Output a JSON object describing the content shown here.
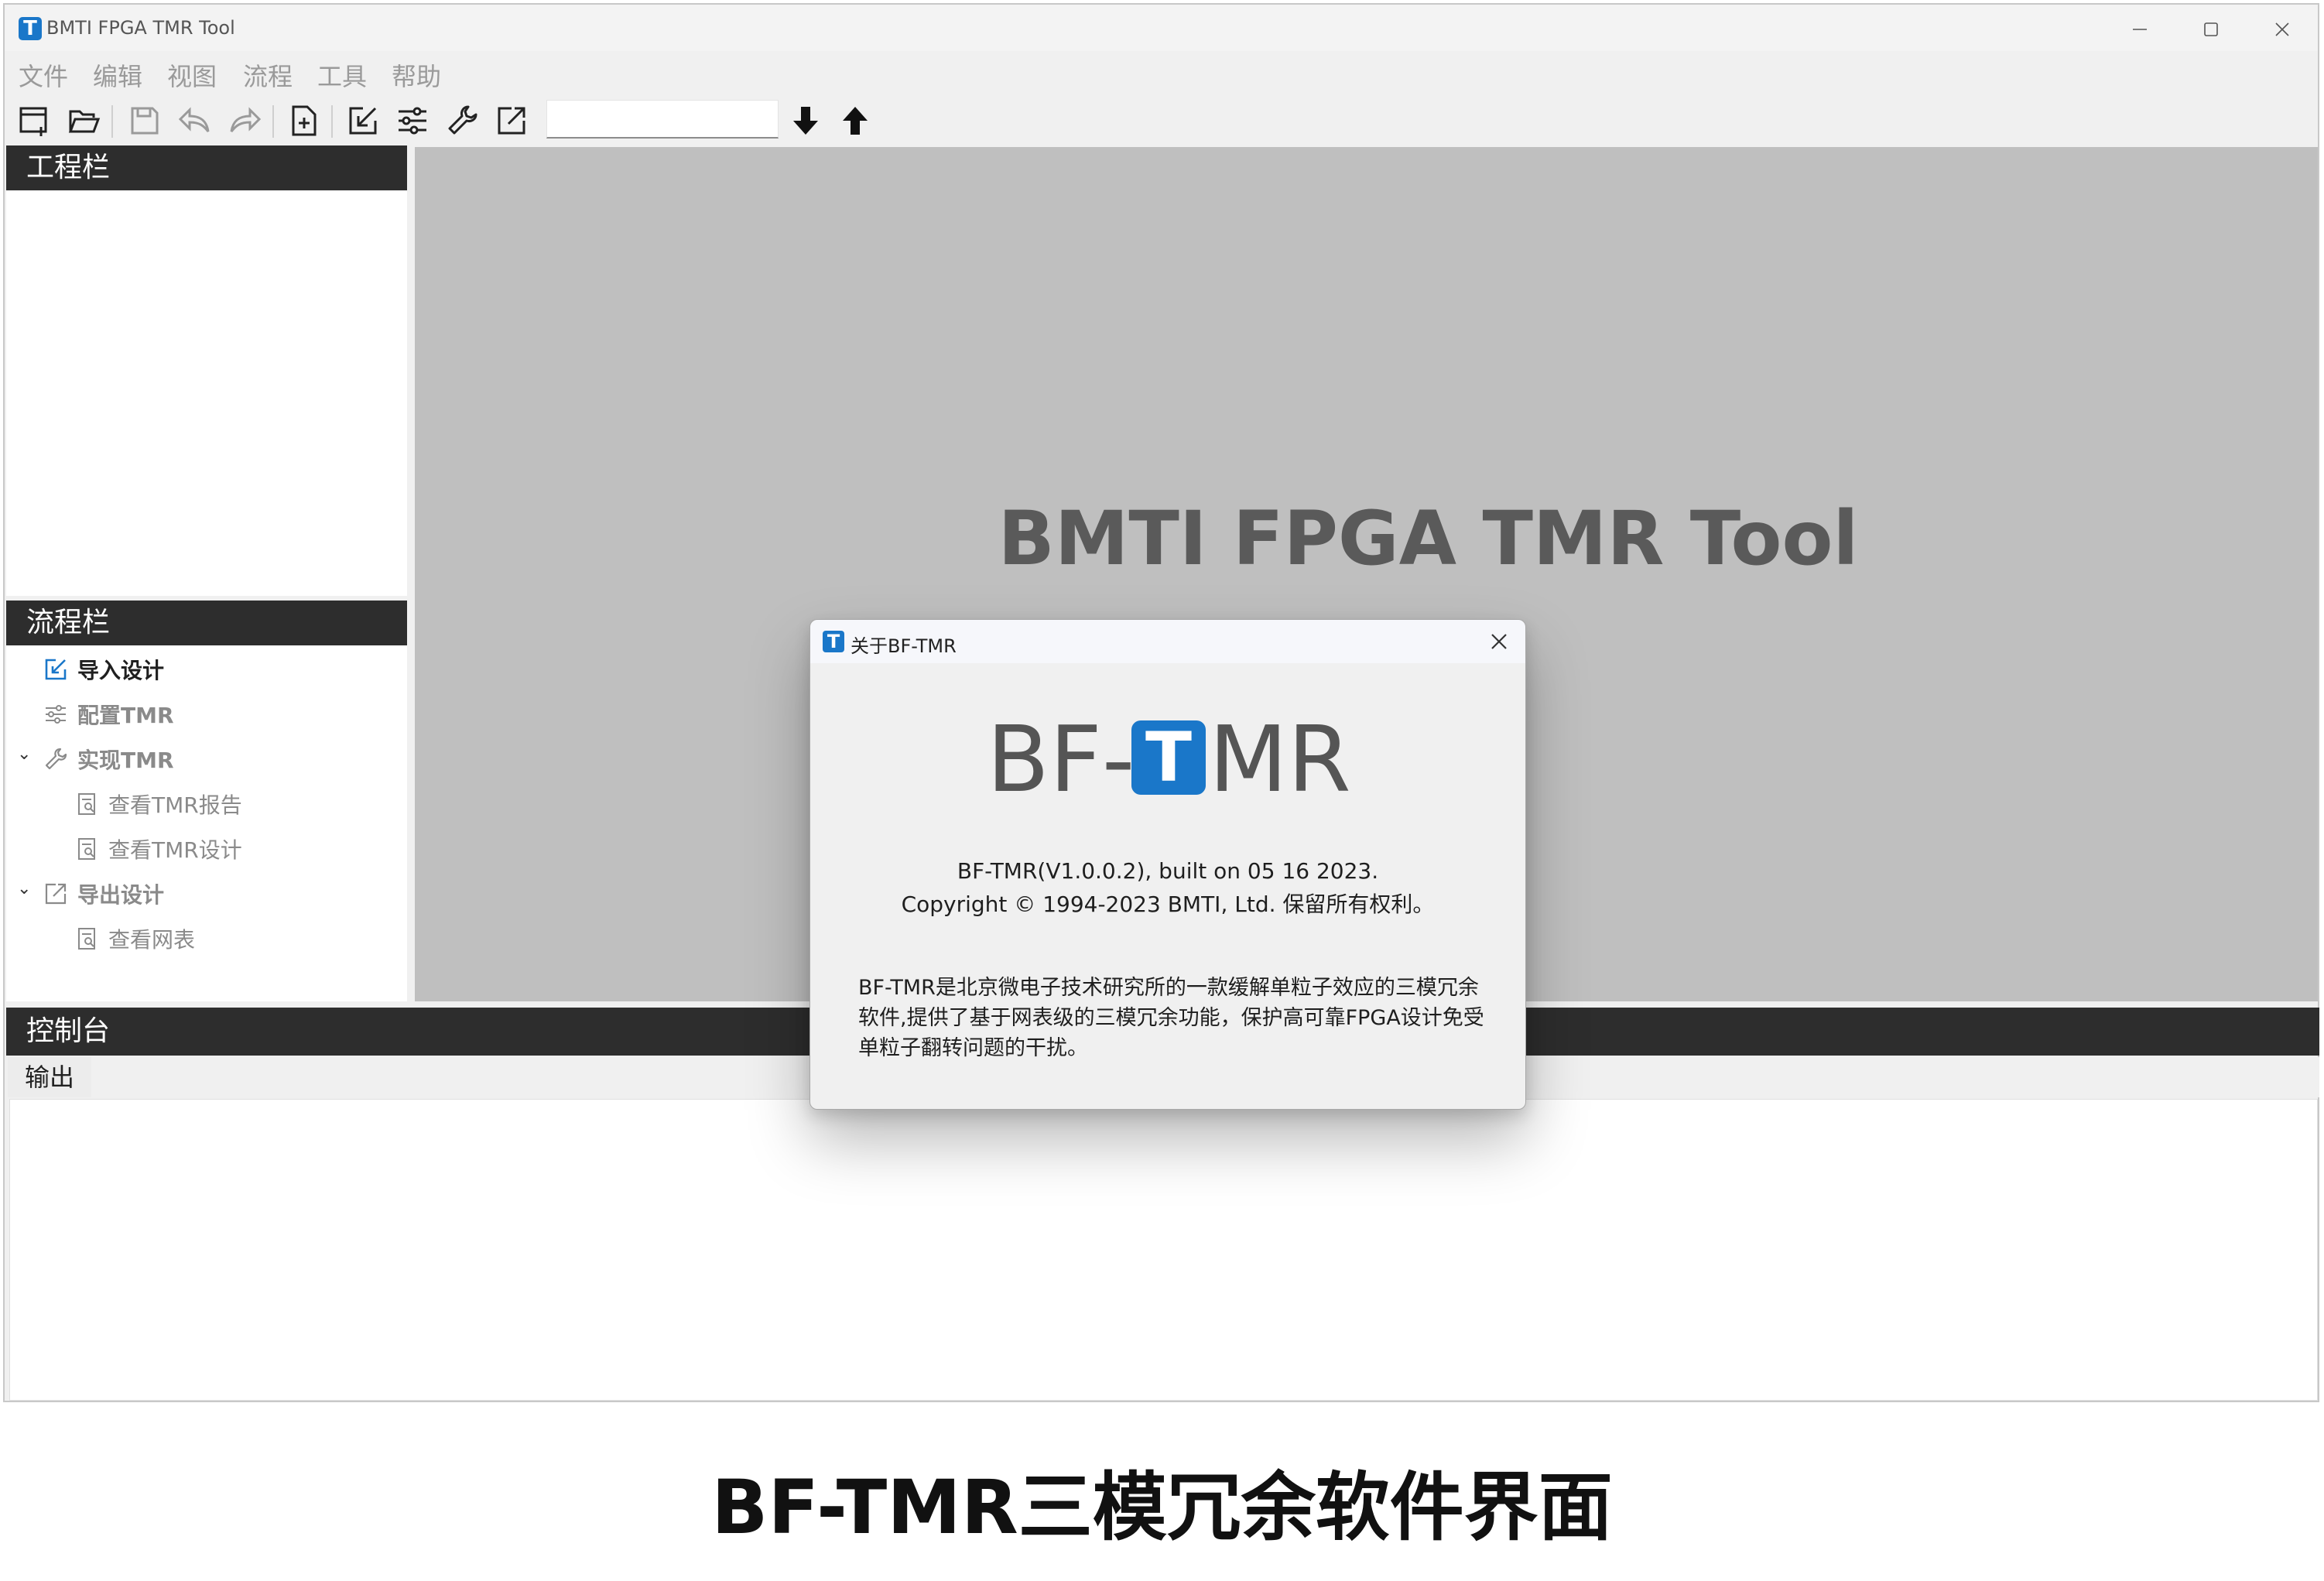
{
  "window": {
    "title": "BMTI FPGA TMR Tool",
    "app_icon_letter": "T",
    "controls": [
      "minimize-icon",
      "maximize-icon",
      "close-icon"
    ]
  },
  "menubar": {
    "items": [
      "文件",
      "编辑",
      "视图",
      "流程",
      "工具",
      "帮助"
    ]
  },
  "toolbar": {
    "buttons": [
      "new-project-icon",
      "open-folder-icon",
      "save-icon",
      "undo-icon",
      "redo-icon",
      "new-file-icon",
      "import-icon",
      "config-sliders-icon",
      "wrench-icon",
      "export-icon"
    ],
    "search_value": "",
    "nav_buttons": [
      "arrow-down-icon",
      "arrow-up-icon"
    ]
  },
  "project_panel": {
    "title": "工程栏"
  },
  "flow_panel": {
    "title": "流程栏",
    "items": [
      {
        "label": "导入设计",
        "level": 0
      },
      {
        "label": "配置TMR",
        "level": 0
      },
      {
        "label": "实现TMR",
        "level": 0,
        "expanded": true
      },
      {
        "label": "查看TMR报告",
        "level": 1
      },
      {
        "label": "查看TMR设计",
        "level": 1
      },
      {
        "label": "导出设计",
        "level": 0,
        "expanded": true
      },
      {
        "label": "查看网表",
        "level": 1
      }
    ]
  },
  "main": {
    "splash_title": "BMTI FPGA TMR Tool"
  },
  "console": {
    "title": "控制台",
    "tab": "输出"
  },
  "dialog": {
    "title": "关于BF-TMR",
    "icon_letter": "T",
    "logo_prefix": "BF-",
    "logo_t": "T",
    "logo_suffix": "MR",
    "version": "BF-TMR(V1.0.0.2), built on 05 16 2023.",
    "copyright": "Copyright © 1994-2023 BMTI, Ltd. 保留所有权利。",
    "description": "BF-TMR是北京微电子技术研究所的一款缓解单粒子效应的三模冗余软件,提供了基于网表级的三模冗余功能，保护高可靠FPGA设计免受单粒子翻转问题的干扰。"
  },
  "caption": "BF-TMR三模冗余软件界面",
  "colors": {
    "accent": "#1a77c9",
    "panel_header": "#2d2d2d",
    "main_bg": "#bfbfbf",
    "window_bg": "#f0f0f0"
  }
}
